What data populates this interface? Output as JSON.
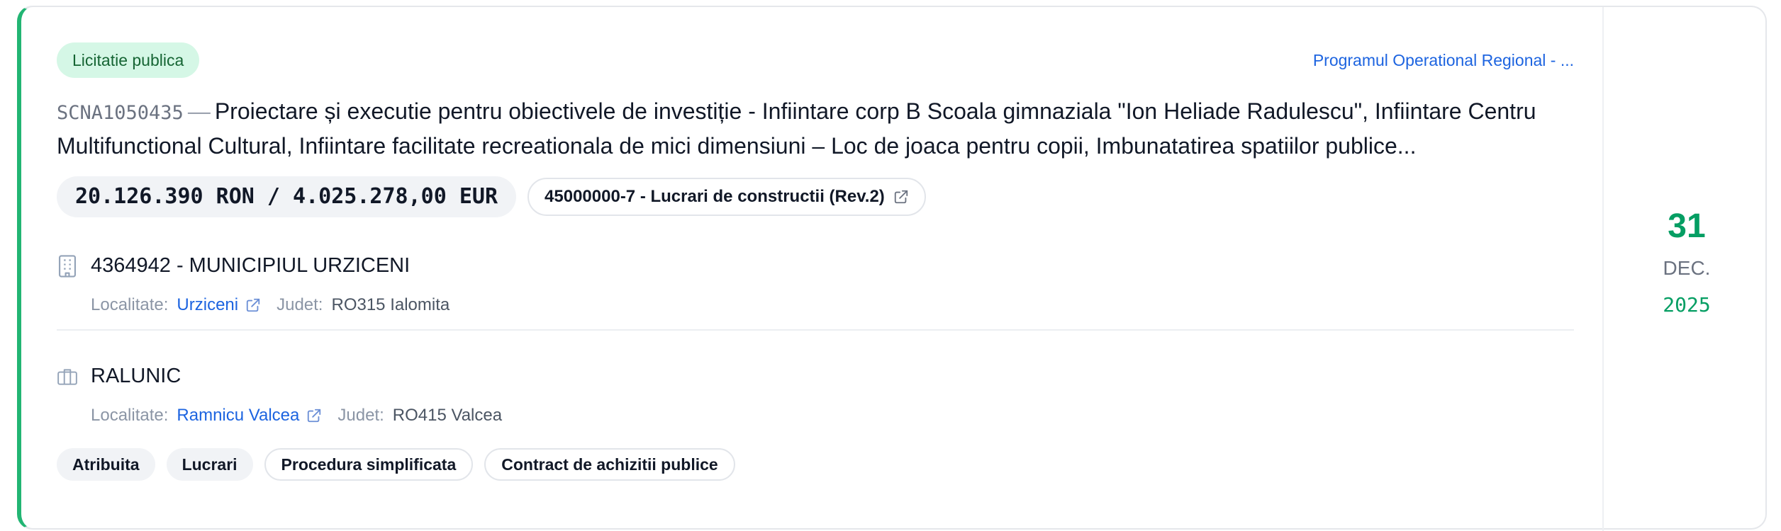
{
  "tender": {
    "type_badge": "Licitatie publica",
    "program": "Programul Operational Regional - ...",
    "code": "SCNA1050435",
    "separator": "—",
    "title": "Proiectare și executie pentru obiectivele de investiție - Infiintare corp B Scoala gimnaziala \"Ion Heliade Radulescu\", Infiintare Centru Multifunctional Cultural, Infiintare facilitate recreationala de mici dimensiuni – Loc de joaca pentru copii, Imbunatatirea spatiilor publice...",
    "value": "20.126.390 RON / 4.025.278,00 EUR",
    "cpv": "45000000-7 - Lucrari de constructii (Rev.2)"
  },
  "contracting_authority": {
    "name": "4364942 - MUNICIPIUL URZICENI",
    "locality_label": "Localitate:",
    "locality": "Urziceni",
    "county_label": "Judet:",
    "county": "RO315 Ialomita"
  },
  "supplier": {
    "name": "RALUNIC",
    "locality_label": "Localitate:",
    "locality": "Ramnicu Valcea",
    "county_label": "Judet:",
    "county": "RO415 Valcea"
  },
  "tags": [
    "Atribuita",
    "Lucrari",
    "Procedura simplificata",
    "Contract de achizitii publice"
  ],
  "date": {
    "day": "31",
    "month": "DEC.",
    "year": "2025"
  },
  "colors": {
    "accent": "#22b573",
    "date_green": "#059e63",
    "link": "#1d64e0",
    "badge_bg": "#d5f7e6"
  },
  "icons": {
    "contracting": "building-icon",
    "supplier": "briefcase-icon",
    "external": "external-link-icon"
  }
}
